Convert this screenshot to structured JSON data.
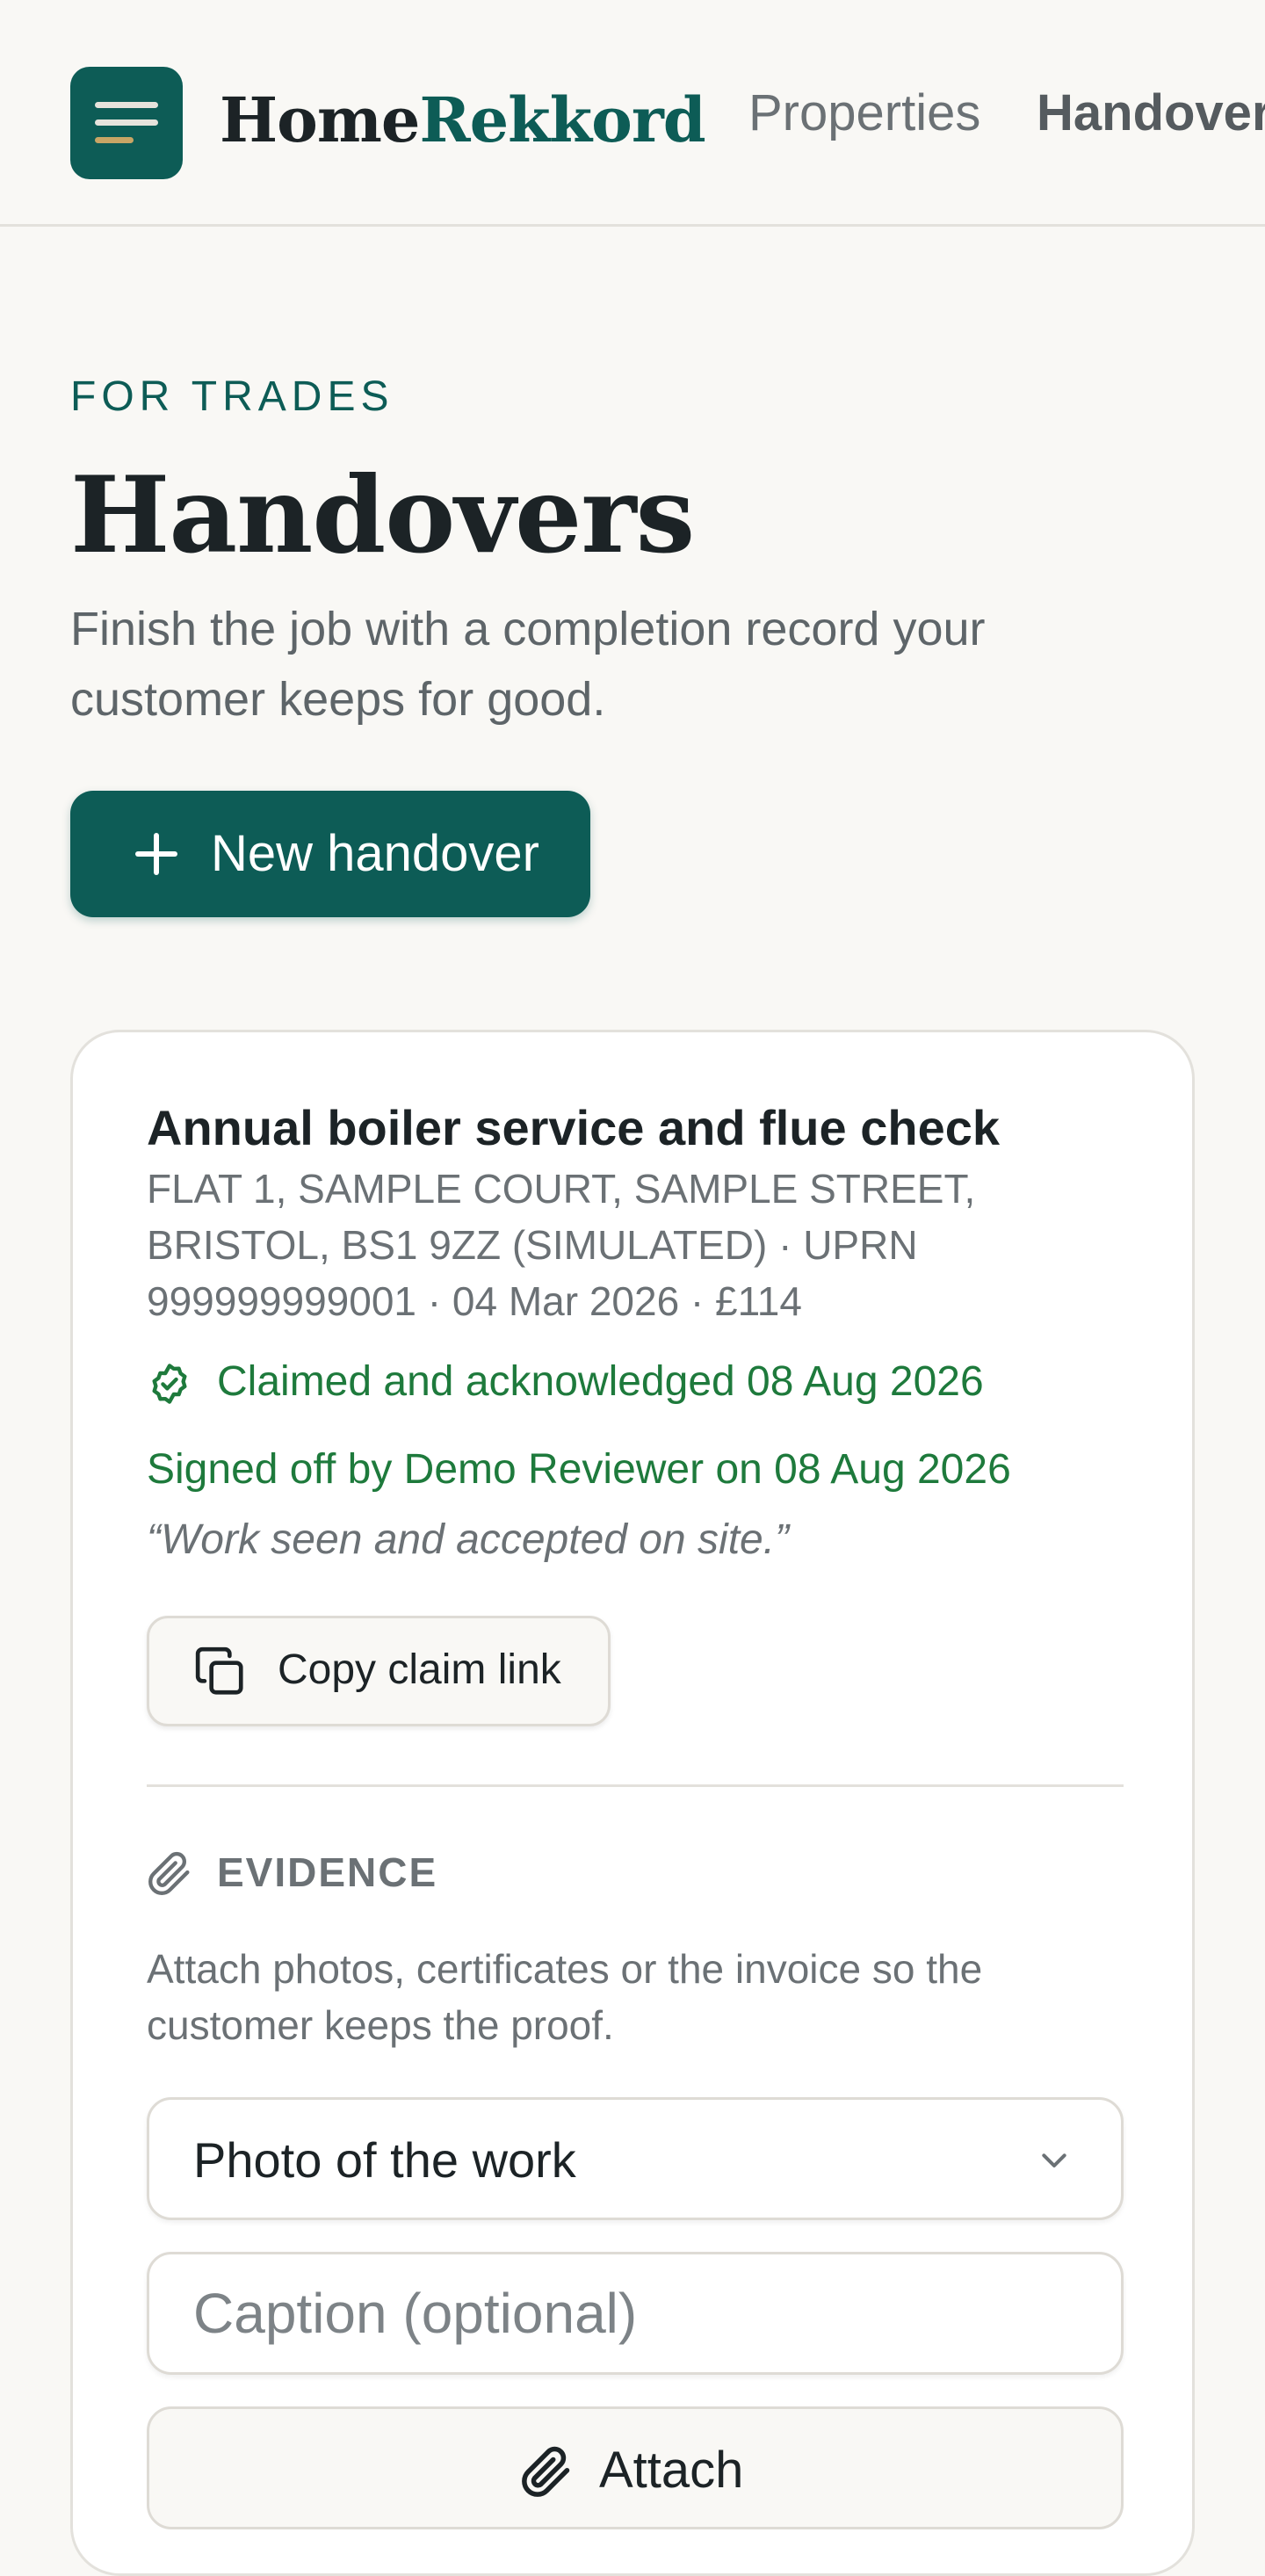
{
  "header": {
    "brand_home": "Home",
    "brand_rekkord": "Rekkord",
    "nav": {
      "properties": "Properties",
      "handovers": "Handovers"
    }
  },
  "hero": {
    "eyebrow": "FOR TRADES",
    "title": "Handovers",
    "lead": "Finish the job with a completion record your customer keeps for good.",
    "new_button": "New handover"
  },
  "handover": {
    "title": "Annual boiler service and flue check",
    "meta": "FLAT 1, SAMPLE COURT, SAMPLE STREET, BRISTOL, BS1 9ZZ (SIMULATED) · UPRN 999999999001 · 04 Mar 2026 · £114",
    "claimed": "Claimed and acknowledged 08 Aug 2026",
    "signed_off": "Signed off by Demo Reviewer on 08 Aug 2026",
    "quote": "“Work seen and accepted on site.”",
    "copy_button": "Copy claim link"
  },
  "evidence": {
    "heading": "EVIDENCE",
    "description": "Attach photos, certificates or the invoice so the customer keeps the proof.",
    "type_selected": "Photo of the work",
    "caption_placeholder": "Caption (optional)",
    "attach_button": "Attach"
  },
  "colors": {
    "primary": "#0d5c56",
    "success": "#1e7a3c",
    "accent": "#c8a565",
    "background": "#f9f8f5"
  }
}
